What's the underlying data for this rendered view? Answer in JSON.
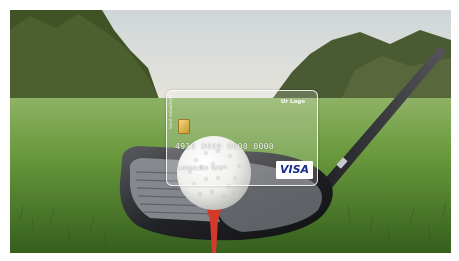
{
  "photo": {
    "card": {
      "logo_text": "Ur Logo",
      "side_text": "YOUR SIGNATURE",
      "card_number": "4910 0000 0000 0000",
      "cardholder": "CARDHOLDER NAME",
      "network": "VISA"
    },
    "colors": {
      "sky": "#d9dde0",
      "grass": "#4f7a2c",
      "club_head": "#2b2b2b",
      "golf_ball": "#f4f4f2",
      "tee": "#d43a2a",
      "visa_blue": "#1a2a8a"
    }
  }
}
